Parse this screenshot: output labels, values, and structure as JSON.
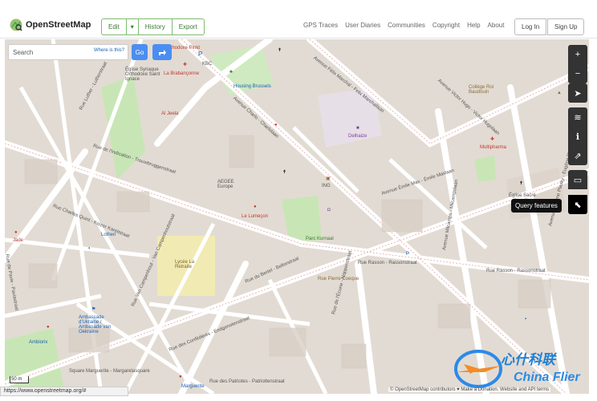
{
  "header": {
    "logo_text": "OpenStreetMap",
    "edit_group": [
      "Edit",
      "History",
      "Export"
    ],
    "nav": [
      "GPS Traces",
      "User Diaries",
      "Communities",
      "Copyright",
      "Help",
      "About"
    ],
    "login": "Log In",
    "signup": "Sign Up"
  },
  "search": {
    "placeholder": "Search",
    "where_is_this": "Where is this?",
    "go": "Go"
  },
  "controls": {
    "tooltip": "Query features"
  },
  "scale": "50 m",
  "status_url": "https://www.openstreetmap.org/#",
  "attribution": "© OpenStreetMap contributors ♥ Make a Donation. Website and API terms",
  "watermark": {
    "line1": "心什科联",
    "line2": "China Flier"
  },
  "map_labels": {
    "orthodox": "Orthodoxe Pinkt",
    "kbc": "KBC",
    "syriaque": "Église Syriaque Orthodoxe Saint Ignace",
    "brabanconne": "La Brabançonne",
    "housing": "Housing Brussels",
    "jacob": "Zuid-Limburgin 116",
    "alpeal": "Al Jeela",
    "avenue_charlo": "Avenue Charlo - Charlolaan",
    "rue_indication": "Rue de l'Indication - Trouwbruggenstraat",
    "rue_luther": "Rue Luther - Lutherstraat",
    "rue_quint": "Rue Charles Quint - Keizer Karelstraat",
    "rue_pavie": "Rue de Pavie - Paviastraat",
    "egee": "AEGEE Europe",
    "ing": "ING",
    "delhaize": "Delhaize",
    "lumeyon": "Le Lumeçon",
    "reflen": "Parc Kurnaal",
    "avenue_felix": "Avenue Félix Marchal - Felix Marchallaan",
    "avenue_victor": "Avenue Victor Hugo - Victor Hugolaan",
    "college": "Collège Roi Baudouin",
    "multipharma": "Multipharma",
    "eglise_sacre": "Église Sacré",
    "avenue_emile": "Avenue Émile Max - Émile Maxlaan",
    "rue_rasson": "Rue Rasson - Rassonstraat",
    "rue_eichel": "Rue du Bertel - Beltorstraat",
    "lycee": "Lycée La Retraite",
    "rue_camp": "Rue Van Campenhout - Van Campenhoutstraat",
    "rue_confed": "Rue des Confédérés - Eedgenotenstraat",
    "rue_patriotes": "Rue des Patriotes - Patriottenstraat",
    "square_marg": "Square Marguerite - Margaretasquare",
    "ambassade": "Ambassade d'Ukraine / Ambasade van Oekraïne",
    "ambiorix": "Ambiorix",
    "rue_pierre": "Rue Pierre Coeque",
    "marguerite": "Marguerite",
    "jade": "Jade",
    "lothen": "Lothen",
    "ave_milcamps": "Avenue Milcamps - Milcampslaan",
    "rue_ecuries": "Rue de l'Écurie - Nappenstraat",
    "plasky": "Avenue Eugène Plasky - Eugène Plaskylaan",
    "ambiorix2": "Parc Kurnaal"
  }
}
